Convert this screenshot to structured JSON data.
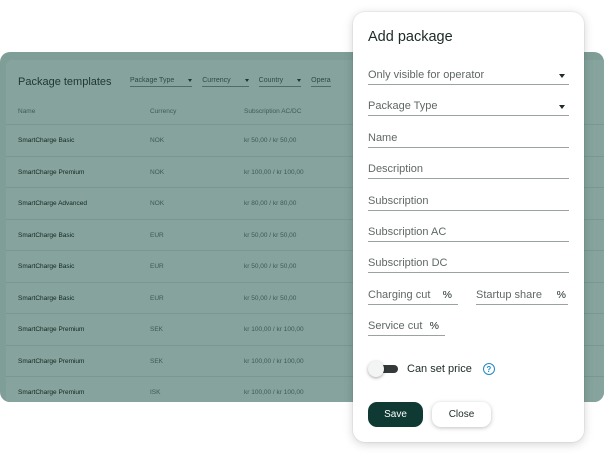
{
  "table": {
    "title": "Package templates",
    "filters": [
      "Package Type",
      "Currency",
      "Country",
      "Opera"
    ],
    "columns": [
      "Name",
      "Currency",
      "Subscription AC/DC"
    ],
    "rows": [
      {
        "name": "SmartCharge Basic",
        "currency": "NOK",
        "subscription": "kr 50,00 / kr 50,00"
      },
      {
        "name": "SmartCharge Premium",
        "currency": "NOK",
        "subscription": "kr 100,00 / kr 100,00"
      },
      {
        "name": "SmartCharge Advanced",
        "currency": "NOK",
        "subscription": "kr 80,00 / kr 80,00"
      },
      {
        "name": "SmartCharge Basic",
        "currency": "EUR",
        "subscription": "kr 50,00 / kr 50,00"
      },
      {
        "name": "SmartCharge Basic",
        "currency": "EUR",
        "subscription": "kr 50,00 / kr 50,00"
      },
      {
        "name": "SmartCharge Basic",
        "currency": "EUR",
        "subscription": "kr 50,00 / kr 50,00"
      },
      {
        "name": "SmartCharge Premium",
        "currency": "SEK",
        "subscription": "kr 100,00 / kr 100,00"
      },
      {
        "name": "SmartCharge Premium",
        "currency": "SEK",
        "subscription": "kr 100,00 / kr 100,00"
      },
      {
        "name": "SmartCharge Premium",
        "currency": "ISK",
        "subscription": "kr 100,00 / kr 100,00"
      }
    ]
  },
  "dialog": {
    "title": "Add package",
    "visibility_select": "Only visible for operator",
    "package_type_select": "Package Type",
    "name_placeholder": "Name",
    "description_placeholder": "Description",
    "subscription_placeholder": "Subscription",
    "subscription_ac_placeholder": "Subscription AC",
    "subscription_dc_placeholder": "Subscription DC",
    "charging_cut_placeholder": "Charging cut",
    "startup_share_placeholder": "Startup share",
    "service_cut_placeholder": "Service cut",
    "percent_unit": "%",
    "can_set_price_label": "Can set price",
    "can_set_price_enabled": false,
    "help_icon": "question-circle-icon",
    "save_label": "Save",
    "close_label": "Close"
  },
  "colors": {
    "overlay_card": "#7f9e97",
    "primary_button": "#0e3a33",
    "help_icon": "#1f8ac7"
  }
}
